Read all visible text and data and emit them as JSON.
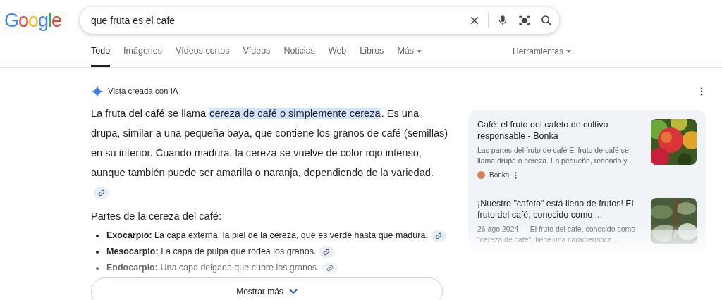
{
  "logo": "Google",
  "search": {
    "value": "que fruta es el cafe"
  },
  "tabs": [
    {
      "label": "Todo",
      "selected": true
    },
    {
      "label": "Imágenes",
      "selected": false
    },
    {
      "label": "Vídeos cortos",
      "selected": false
    },
    {
      "label": "Vídeos",
      "selected": false
    },
    {
      "label": "Noticias",
      "selected": false
    },
    {
      "label": "Web",
      "selected": false
    },
    {
      "label": "Libros",
      "selected": false
    },
    {
      "label": "Más",
      "selected": false,
      "menu": true
    }
  ],
  "tools": "Herramientas",
  "ai_overview": {
    "label": "Vista creada con IA",
    "summary": {
      "before": "La fruta del café se llama ",
      "highlight": "cereza de café o simplemente cereza",
      "after": ". Es una drupa, similar a una pequeña baya, que contiene los granos de café (semillas) en su interior. Cuando madura, la cereza se vuelve de color rojo intenso, aunque también puede ser amarilla o naranja, dependiendo de la variedad."
    },
    "heading": "Partes de la cereza del café:",
    "parts": [
      {
        "term": "Exocarpio:",
        "text": "La capa externa, la piel de la cereza, que es verde hasta que madura."
      },
      {
        "term": "Mesocarpio:",
        "text": "La capa de pulpa que rodea los granos."
      },
      {
        "term": "Endocarpio:",
        "text": "Una capa delgada que cubre los granos."
      }
    ],
    "show_more": "Mostrar más"
  },
  "sources": [
    {
      "title": "Café: el fruto del cafeto de cultivo responsable - Bonka",
      "snippet": "Las partes del fruto de café El fruto de café se llama drupa o cereza. Es pequeño, redondo y...",
      "site": "Bonka"
    },
    {
      "title": "¡Nuestro \"cafeto\" está lleno de frutos! El fruto del café, conocido como ...",
      "snippet": "26 ago 2024 — El fruto del café, conocido como \"cereza de café\", tiene una característica ..."
    }
  ]
}
